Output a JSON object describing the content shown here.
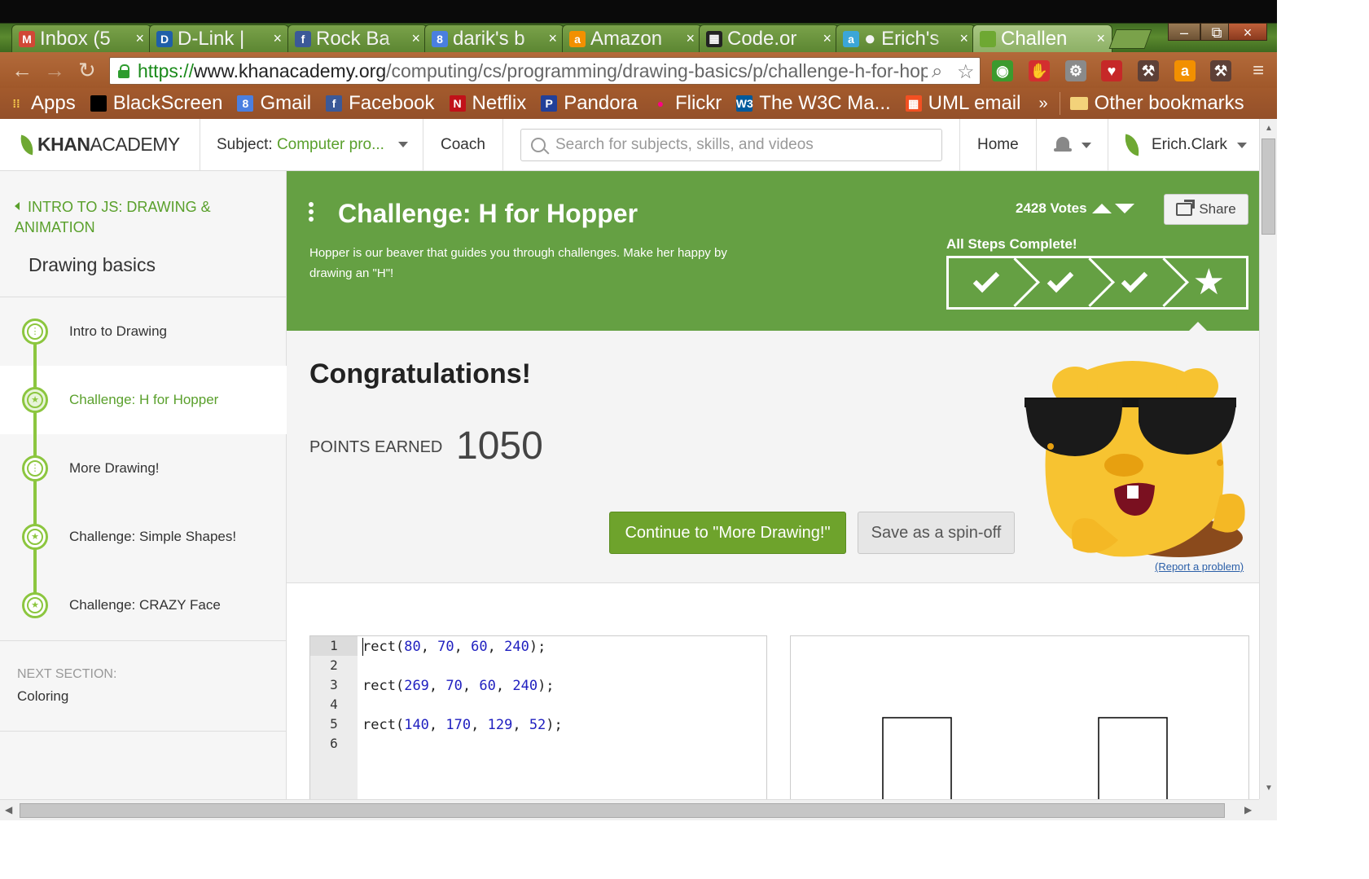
{
  "browser": {
    "tabs": [
      {
        "label": "Inbox (5",
        "icon": "gmail-icon",
        "color": "#d14836",
        "glyph": "M"
      },
      {
        "label": "D-Link |",
        "icon": "dlink-icon",
        "color": "#1f5fa8",
        "glyph": "D"
      },
      {
        "label": "Rock Ba",
        "icon": "facebook-icon",
        "color": "#3b5998",
        "glyph": "f"
      },
      {
        "label": "darik's b",
        "icon": "google-icon",
        "color": "#4a7fe0",
        "glyph": "8"
      },
      {
        "label": "Amazon",
        "icon": "amazon-icon",
        "color": "#f29000",
        "glyph": "a"
      },
      {
        "label": "Code.or",
        "icon": "codeorg-icon",
        "color": "#222222",
        "glyph": "▦"
      },
      {
        "label": "● Erich's",
        "icon": "app-icon",
        "color": "#3ba6d8",
        "glyph": "a"
      },
      {
        "label": "Challen",
        "icon": "khan-leaf-icon",
        "color": "#6ea832",
        "glyph": ""
      }
    ],
    "tab_close": "×",
    "window_buttons": {
      "minimize": "–",
      "restore": "⧉",
      "close": "×"
    },
    "nav": {
      "back": "←",
      "forward": "→",
      "reload": "↻"
    },
    "url": {
      "scheme": "https://",
      "host": "www.khanacademy.org",
      "path": "/computing/cs/programming/drawing-basics/p/challenge-h-for-hopper"
    },
    "omnibox_icons": {
      "search": "⌕",
      "star": "☆"
    },
    "extensions": [
      {
        "name": "green-ext-icon",
        "color": "#3c9a2e",
        "glyph": "◉"
      },
      {
        "name": "adblock-icon",
        "color": "#d32f2f",
        "glyph": "✋"
      },
      {
        "name": "gear-ext-icon",
        "color": "#8a8a8a",
        "glyph": "⚙"
      },
      {
        "name": "heart-ext-icon",
        "color": "#c62828",
        "glyph": "♥"
      },
      {
        "name": "tool-ext-icon",
        "color": "#5d4037",
        "glyph": "⚒"
      },
      {
        "name": "amazon-ext-icon",
        "color": "#f29000",
        "glyph": "a"
      },
      {
        "name": "tool2-ext-icon",
        "color": "#5d4037",
        "glyph": "⚒"
      },
      {
        "name": "menu-icon",
        "color": "#8d5a36",
        "glyph": "≡"
      }
    ],
    "bookmarks": [
      {
        "label": "Apps",
        "icon": "apps-icon",
        "color": "#e53935",
        "glyph": "⁞⁞"
      },
      {
        "label": "BlackScreen",
        "icon": "blackscreen-icon",
        "color": "#000000",
        "glyph": ""
      },
      {
        "label": "Gmail",
        "icon": "google-icon",
        "color": "#4a7fe0",
        "glyph": "8"
      },
      {
        "label": "Facebook",
        "icon": "facebook-icon",
        "color": "#3b5998",
        "glyph": "f"
      },
      {
        "label": "Netflix",
        "icon": "netflix-icon",
        "color": "#c11119",
        "glyph": "N"
      },
      {
        "label": "Pandora",
        "icon": "pandora-icon",
        "color": "#224099",
        "glyph": "P"
      },
      {
        "label": "Flickr",
        "icon": "flickr-icon",
        "color": "#0063dc",
        "glyph": "●"
      },
      {
        "label": "The W3C Ma...",
        "icon": "w3c-icon",
        "color": "#005a9c",
        "glyph": "W3"
      },
      {
        "label": "UML email",
        "icon": "windows-icon",
        "color": "#f25022",
        "glyph": "▦"
      }
    ],
    "bookmarks_overflow": "»",
    "other_bookmarks": "Other bookmarks"
  },
  "header": {
    "logo_bold": "KHAN",
    "logo_light": "ACADEMY",
    "subject_label": "Subject:",
    "subject_value": "Computer pro...",
    "coach": "Coach",
    "search_placeholder": "Search for subjects, skills, and videos",
    "home": "Home",
    "user": "Erich.Clark"
  },
  "sidebar": {
    "section": "INTRO TO JS: DRAWING & ANIMATION",
    "title": "Drawing basics",
    "items": [
      {
        "label": "Intro to Drawing",
        "type": "talkthrough",
        "glyph": "⋮"
      },
      {
        "label": "Challenge: H for Hopper",
        "type": "challenge",
        "glyph": "★",
        "active": true
      },
      {
        "label": "More Drawing!",
        "type": "talkthrough",
        "glyph": "⋮"
      },
      {
        "label": "Challenge: Simple Shapes!",
        "type": "challenge",
        "glyph": "★"
      },
      {
        "label": "Challenge: CRAZY Face",
        "type": "challenge",
        "glyph": "★"
      }
    ],
    "next_label": "NEXT SECTION:",
    "next_value": "Coloring"
  },
  "challenge": {
    "title": "Challenge: H for Hopper",
    "description": "Hopper is our beaver that guides you through challenges. Make her happy by drawing an \"H\"!",
    "votes": "2428 Votes",
    "share": "Share",
    "steps_label": "All Steps Complete!",
    "steps": [
      "check",
      "check",
      "check",
      "star"
    ],
    "colors": {
      "banner": "#65a043",
      "accent": "#5aa02c"
    }
  },
  "result": {
    "heading": "Congratulations!",
    "points_label": "POINTS EARNED",
    "points_value": "1050",
    "continue_button": "Continue to \"More Drawing!\"",
    "spinoff_button": "Save as a spin-off",
    "report": "(Report a problem)"
  },
  "editor": {
    "line_numbers": [
      "1",
      "2",
      "3",
      "4",
      "5",
      "6"
    ],
    "lines": [
      {
        "fn": "rect",
        "args": [
          "80",
          "70",
          "60",
          "240"
        ]
      },
      null,
      {
        "fn": "rect",
        "args": [
          "269",
          "70",
          "60",
          "240"
        ]
      },
      null,
      {
        "fn": "rect",
        "args": [
          "140",
          "170",
          "129",
          "52"
        ]
      },
      null
    ]
  }
}
